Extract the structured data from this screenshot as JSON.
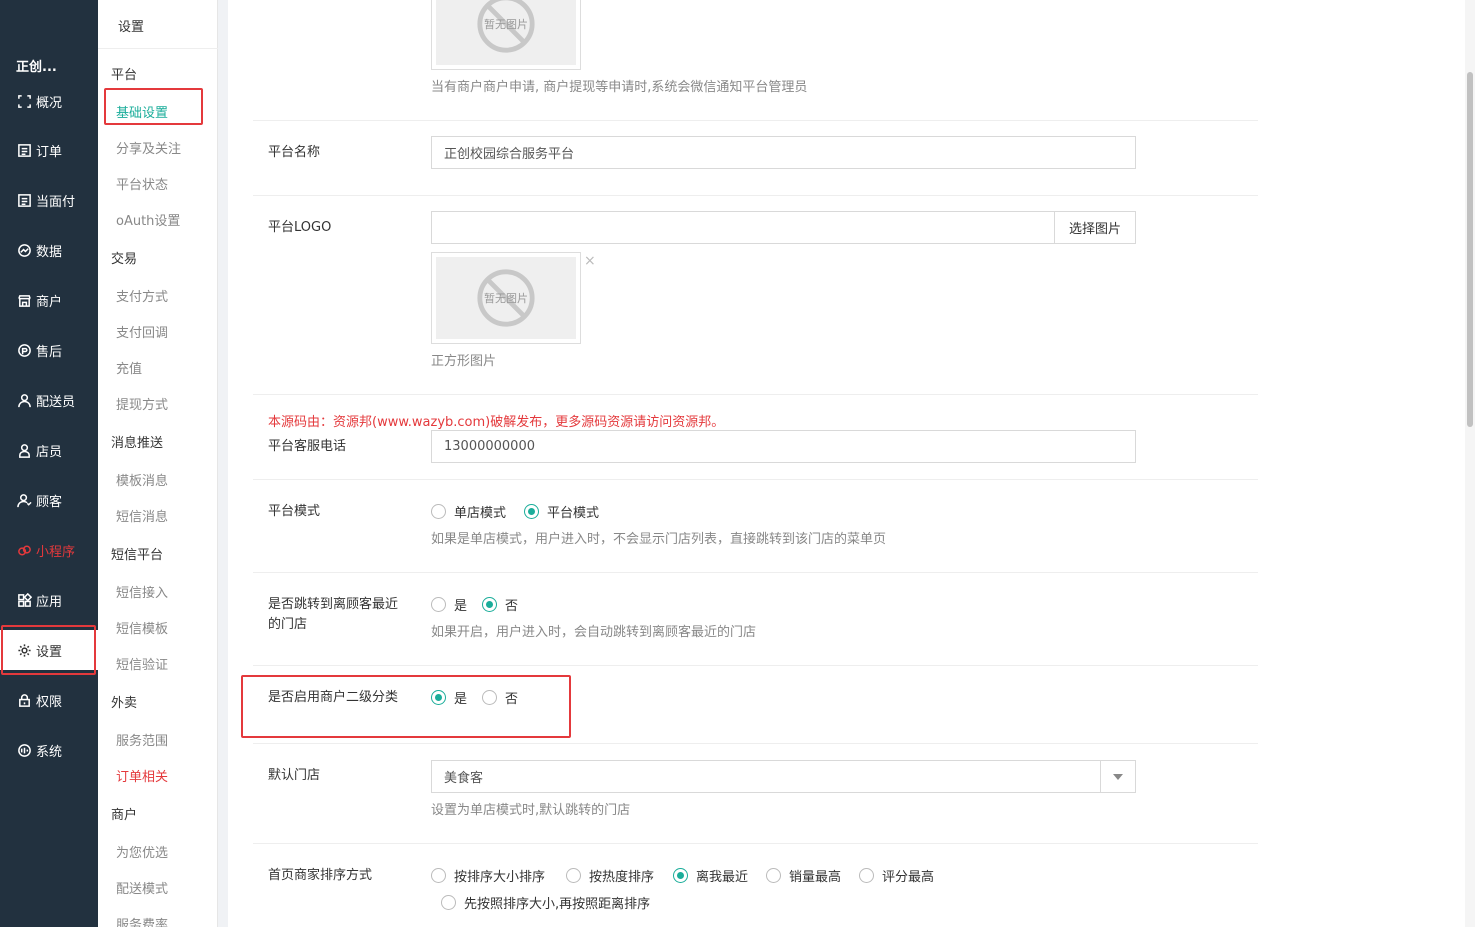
{
  "nav": {
    "brand": "正创...",
    "items": [
      {
        "label": "概况",
        "icon": "dashboard-icon"
      },
      {
        "label": "订单",
        "icon": "order-icon"
      },
      {
        "label": "当面付",
        "icon": "payment-icon"
      },
      {
        "label": "数据",
        "icon": "data-icon"
      },
      {
        "label": "商户",
        "icon": "store-icon"
      },
      {
        "label": "售后",
        "icon": "after-sale-icon"
      },
      {
        "label": "配送员",
        "icon": "courier-icon"
      },
      {
        "label": "店员",
        "icon": "clerk-icon"
      },
      {
        "label": "顾客",
        "icon": "customer-icon"
      },
      {
        "label": "小程序",
        "icon": "miniprogram-icon"
      },
      {
        "label": "应用",
        "icon": "apps-icon"
      },
      {
        "label": "设置",
        "icon": "gear-icon"
      },
      {
        "label": "权限",
        "icon": "lock-icon"
      },
      {
        "label": "系统",
        "icon": "system-icon"
      }
    ]
  },
  "sub": {
    "head": "设置",
    "groups": {
      "platform": "平台",
      "trade": "交易",
      "message": "消息推送",
      "sms": "短信平台",
      "takeout": "外卖",
      "merchant": "商户"
    },
    "links": {
      "basic": "基础设置",
      "share": "分享及关注",
      "status": "平台状态",
      "oauth": "oAuth设置",
      "pay_method": "支付方式",
      "pay_callback": "支付回调",
      "recharge": "充值",
      "withdraw": "提现方式",
      "template_msg": "模板消息",
      "sms_msg": "短信消息",
      "sms_access": "短信接入",
      "sms_template": "短信模板",
      "sms_verify": "短信验证",
      "service_range": "服务范围",
      "order_related": "订单相关",
      "recommend": "为您优选",
      "delivery_mode": "配送模式",
      "service_fee": "服务费率"
    }
  },
  "form": {
    "top_hint": "当有商户商户申请, 商户提现等申请时,系统会微信通知平台管理员",
    "no_image": "暂无图片",
    "platform_name": {
      "label": "平台名称",
      "value": "正创校园综合服务平台"
    },
    "logo": {
      "label": "平台LOGO",
      "value": "",
      "button": "选择图片",
      "close": "×",
      "hint": "正方形图片"
    },
    "notice": "本源码由：资源邦(www.wazyb.com)破解发布，更多源码资源请访问资源邦。",
    "phone": {
      "label": "平台客服电话",
      "value": "13000000000"
    },
    "mode": {
      "label": "平台模式",
      "opt1": "单店模式",
      "opt2": "平台模式",
      "hint": "如果是单店模式，用户进入时，不会显示门店列表，直接跳转到该门店的菜单页"
    },
    "jump": {
      "label": "是否跳转到离顾客最近的门店",
      "opt1": "是",
      "opt2": "否",
      "hint": "如果开启，用户进入时，会自动跳转到离顾客最近的门店"
    },
    "subcat": {
      "label": "是否启用商户二级分类",
      "opt1": "是",
      "opt2": "否"
    },
    "default_store": {
      "label": "默认门店",
      "value": "美食客",
      "hint": "设置为单店模式时,默认跳转的门店"
    },
    "sort": {
      "label": "首页商家排序方式",
      "opts": [
        "按排序大小排序",
        "按热度排序",
        "离我最近",
        "销量最高",
        "评分最高"
      ],
      "opt6": "先按照排序大小,再按照距离排序"
    }
  }
}
